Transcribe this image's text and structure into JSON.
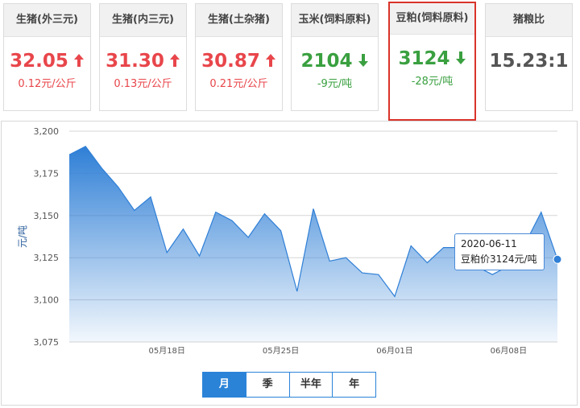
{
  "cards": [
    {
      "title": "生猪(外三元)",
      "price": "32.05",
      "change": "0.12元/公斤",
      "direction": "up"
    },
    {
      "title": "生猪(内三元)",
      "price": "31.30",
      "change": "0.13元/公斤",
      "direction": "up"
    },
    {
      "title": "生猪(土杂猪)",
      "price": "30.87",
      "change": "0.21元/公斤",
      "direction": "up"
    },
    {
      "title": "玉米(饲料原料)",
      "price": "2104",
      "change": "-9元/吨",
      "direction": "down"
    },
    {
      "title": "豆粕(饲料原料)",
      "price": "3124",
      "change": "-28元/吨",
      "direction": "down",
      "selected": true
    },
    {
      "title": "猪粮比",
      "price": "15.23:1",
      "change": "",
      "direction": "none"
    }
  ],
  "colors": {
    "up": "#e8464b",
    "down": "#3aa040",
    "accent": "#2b83d8",
    "highlight_border": "#d9332a"
  },
  "chart_data": {
    "type": "area",
    "ylabel": "元/吨",
    "ylim": [
      3075,
      3200
    ],
    "yticks": [
      "3,200",
      "3,175",
      "3,150",
      "3,125",
      "3,100",
      "3,075"
    ],
    "x": [
      "2020-05-12",
      "2020-05-13",
      "2020-05-14",
      "2020-05-15",
      "2020-05-16",
      "2020-05-17",
      "2020-05-18",
      "2020-05-19",
      "2020-05-20",
      "2020-05-21",
      "2020-05-22",
      "2020-05-23",
      "2020-05-24",
      "2020-05-25",
      "2020-05-26",
      "2020-05-27",
      "2020-05-28",
      "2020-05-29",
      "2020-05-30",
      "2020-05-31",
      "2020-06-01",
      "2020-06-02",
      "2020-06-03",
      "2020-06-04",
      "2020-06-05",
      "2020-06-06",
      "2020-06-07",
      "2020-06-08",
      "2020-06-09",
      "2020-06-10",
      "2020-06-11"
    ],
    "values": [
      3186,
      3191,
      3178,
      3167,
      3153,
      3161,
      3128,
      3142,
      3126,
      3152,
      3147,
      3137,
      3151,
      3141,
      3105,
      3154,
      3123,
      3125,
      3116,
      3115,
      3102,
      3132,
      3122,
      3131,
      3131,
      3120,
      3115,
      3120,
      3133,
      3152,
      3124
    ],
    "xtick_labels": [
      {
        "label": "05月18日",
        "date": "2020-05-18"
      },
      {
        "label": "05月25日",
        "date": "2020-05-25"
      },
      {
        "label": "06月01日",
        "date": "2020-06-01"
      },
      {
        "label": "06月08日",
        "date": "2020-06-08"
      }
    ],
    "grid": true,
    "tooltip": {
      "date": "2020-06-11",
      "text": "豆粕价3124元/吨"
    }
  },
  "periods": [
    "月",
    "季",
    "半年",
    "年"
  ],
  "active_period": "月"
}
